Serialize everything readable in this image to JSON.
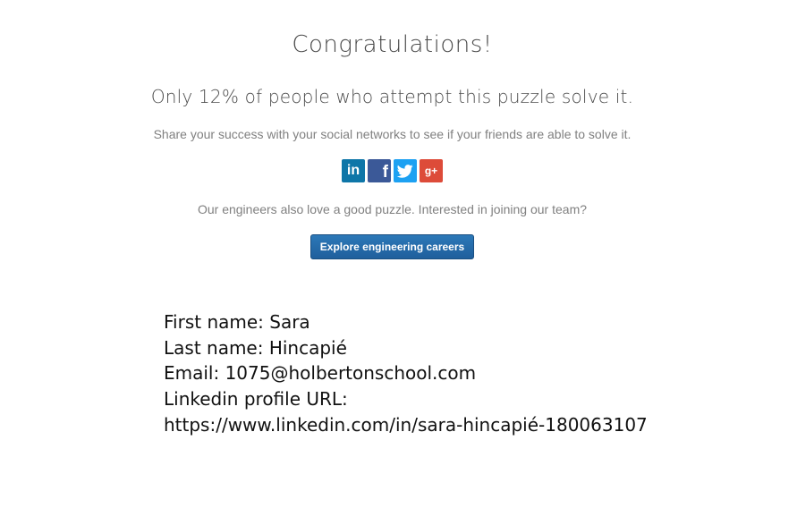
{
  "heading": {
    "title": "Congratulations!",
    "subtitle": "Only 12% of people who attempt this puzzle solve it."
  },
  "share": {
    "text": "Share your success with your social networks to see if your friends are able to solve it.",
    "networks": [
      {
        "name": "linkedin",
        "icon": "linkedin-icon",
        "glyph": "in",
        "color": "#0e76a8"
      },
      {
        "name": "facebook",
        "icon": "facebook-icon",
        "glyph": "f",
        "color": "#3b5998"
      },
      {
        "name": "twitter",
        "icon": "twitter-icon",
        "glyph": "bird",
        "color": "#1da1f2"
      },
      {
        "name": "google-plus",
        "icon": "google-plus-icon",
        "glyph": "g+",
        "color": "#dd4b39"
      }
    ]
  },
  "careers": {
    "text": "Our engineers also love a good puzzle. Interested in joining our team?",
    "button_label": "Explore engineering careers",
    "button_color": "#2a6fad"
  },
  "info": {
    "first_name": "First name: Sara",
    "last_name": "Last name: Hincapié",
    "email": "Email: 1075@holbertonschool.com",
    "linkedin_label": "Linkedin profile URL:",
    "linkedin_url": "https://www.linkedin.com/in/sara-hincapié-180063107"
  }
}
